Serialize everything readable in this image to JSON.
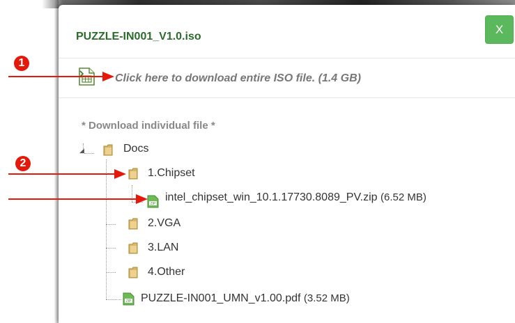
{
  "modal": {
    "title": "PUZZLE-IN001_V1.0.iso",
    "close_label": "X",
    "iso_link": "Click here to download entire ISO file. (1.4 GB)",
    "download_individual_label": "* Download individual file *"
  },
  "tree": {
    "root": "Docs",
    "chipset": "1.Chipset",
    "chipset_file_name": "intel_chipset_win_10.1.17730.8089_PV.zip",
    "chipset_file_size": "(6.52 MB)",
    "vga": "2.VGA",
    "lan": "3.LAN",
    "other": "4.Other",
    "manual_name": "PUZZLE-IN001_UMN_v1.00.pdf",
    "manual_size": "(3.52 MB)"
  },
  "annotations": {
    "badge_1": "1",
    "badge_2": "2"
  },
  "colors": {
    "title": "#2b6b2b",
    "close_button": "#5cb85c",
    "annotation_red": "#e3190b",
    "folder": "#d9b66a",
    "zip": "#6dbb55"
  },
  "icons": {
    "iso": "spreadsheet-download-icon",
    "folder": "folder-icon",
    "zip": "zip-file-icon"
  }
}
